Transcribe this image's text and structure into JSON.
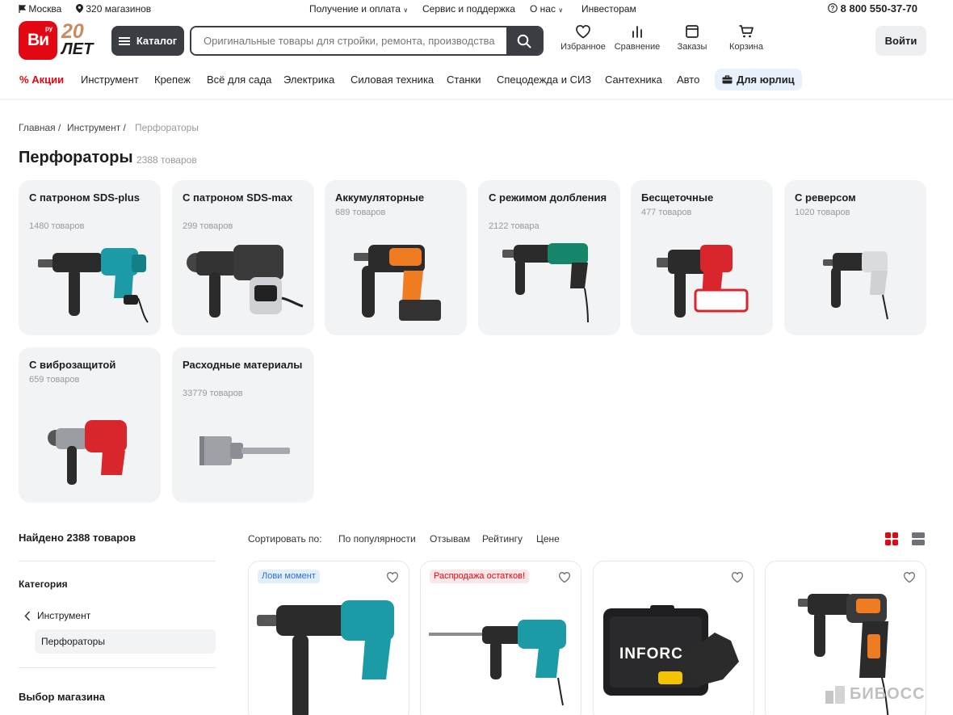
{
  "topbar": {
    "city": "Москва",
    "stores": "320 магазинов",
    "links": [
      "Получение и оплата",
      "Сервис и поддержка",
      "О нас",
      "Инвесторам"
    ],
    "phone": "8 800 550-37-70"
  },
  "logo": {
    "main": "Ви",
    "ru": "ру",
    "years": "20",
    "years_word": "ЛЕТ"
  },
  "header": {
    "catalog_label": "Каталог",
    "search_placeholder": "Оригинальные товары для стройки, ремонта, производства",
    "icons": [
      {
        "label": "Избранное",
        "icon": "heart-icon"
      },
      {
        "label": "Сравнение",
        "icon": "compare-icon"
      },
      {
        "label": "Заказы",
        "icon": "orders-icon"
      },
      {
        "label": "Корзина",
        "icon": "cart-icon"
      }
    ],
    "login_label": "Войти"
  },
  "nav": {
    "sale": "Акции",
    "items": [
      "Инструмент",
      "Крепеж",
      "Всё для сада",
      "Электрика",
      "Силовая техника",
      "Станки",
      "Спецодежда и СИЗ",
      "Сантехника",
      "Авто"
    ],
    "corporate": "Для юрлиц"
  },
  "breadcrumb": [
    "Главная",
    "Инструмент",
    "Перфораторы"
  ],
  "page": {
    "title": "Перфораторы",
    "count": "2388 товаров"
  },
  "categories": [
    {
      "title": "С патроном SDS-plus",
      "count": "1480 товаров"
    },
    {
      "title": "С патроном SDS-max",
      "count": "299 товаров"
    },
    {
      "title": "Аккумуляторные",
      "count": "689 товаров"
    },
    {
      "title": "С режимом долбления",
      "count": "2122 товара"
    },
    {
      "title": "Бесщеточные",
      "count": "477 товаров"
    },
    {
      "title": "С реверсом",
      "count": "1020 товаров"
    },
    {
      "title": "С виброзащитой",
      "count": "659 товаров"
    },
    {
      "title": "Расходные материалы",
      "count": "33779 товаров"
    }
  ],
  "listing": {
    "found": "Найдено 2388 товаров",
    "sort_label": "Сортировать по:",
    "sort_options": [
      "По популярности",
      "Отзывам",
      "Рейтингу",
      "Цене"
    ]
  },
  "sidebar": {
    "category_heading": "Категория",
    "back_item": "Инструмент",
    "active_item": "Перфораторы",
    "store_heading": "Выбор магазина"
  },
  "products": [
    {
      "badge": "Лови момент"
    },
    {
      "badge": "Распродажа остатков!"
    },
    {
      "badge": ""
    },
    {
      "badge": ""
    }
  ],
  "product_brands": {
    "case_brand": "INFORC"
  },
  "watermark": "БИБОСС",
  "colors": {
    "brand_red": "#e30613",
    "dark": "#3a3d42",
    "card_bg": "#f2f3f5",
    "makita_teal": "#1c9aa5",
    "aeg_orange": "#f07c22"
  }
}
